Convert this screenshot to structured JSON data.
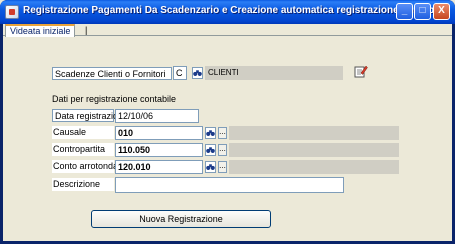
{
  "window": {
    "title": "Registrazione Pagamenti Da Scadenzario e Creazione automatica registrazione contabile",
    "minimize": "_",
    "maximize": "□",
    "close": "X"
  },
  "tabs": {
    "active": "Videata iniziale",
    "separator": "|"
  },
  "scadenze": {
    "label": "Scadenze Clienti o Fornitori",
    "code": "C",
    "description": "CLIENTI"
  },
  "section_heading": "Dati per registrazione contabile",
  "form": {
    "data_registrazione": {
      "label": "Data registrazione",
      "value": "12/10/06"
    },
    "causale": {
      "label": "Causale",
      "value": "010",
      "dots": "..."
    },
    "contropartita": {
      "label": "Contropartita",
      "value": "110.050",
      "dots": "..."
    },
    "conto_arrotondamenti": {
      "label": "Conto arrotondamenti",
      "value": "120.010",
      "dots": "..."
    },
    "descrizione": {
      "label": "Descrizione",
      "value": ""
    }
  },
  "actions": {
    "nuova_registrazione": "Nuova Registrazione"
  },
  "icons": [
    "app-icon",
    "binoculars-icon",
    "edit-icon"
  ]
}
